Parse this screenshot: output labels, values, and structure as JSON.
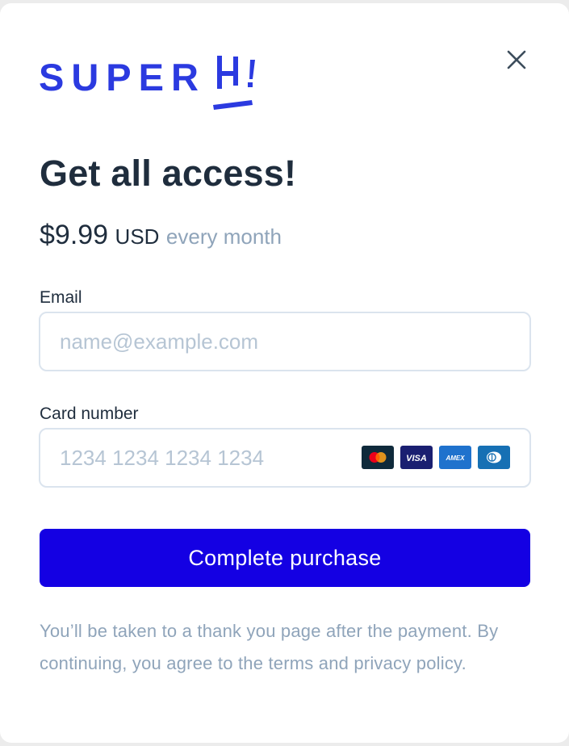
{
  "brand": {
    "name": "SUPER",
    "accent_color": "#2b3ae0"
  },
  "header": {
    "title": "Get all access!",
    "close_icon": "close-icon"
  },
  "pricing": {
    "amount": "$9.99",
    "currency": "USD",
    "period": "every month"
  },
  "form": {
    "email": {
      "label": "Email",
      "placeholder": "name@example.com",
      "value": ""
    },
    "card": {
      "label": "Card number",
      "placeholder": "1234 1234 1234 1234",
      "value": "",
      "brands": [
        "mastercard-icon",
        "visa-icon",
        "amex-icon",
        "diners-icon"
      ],
      "visa_text": "VISA",
      "amex_text": "AMEX"
    }
  },
  "actions": {
    "submit_label": "Complete purchase",
    "submit_color": "#1400e3"
  },
  "footer": {
    "disclaimer": "You’ll be taken to a thank you page after the payment. By continuing, you agree to the terms and privacy policy."
  },
  "colors": {
    "text_primary": "#1f2d3d",
    "text_muted": "#8fa4ba",
    "field_border": "#dbe4ee"
  }
}
